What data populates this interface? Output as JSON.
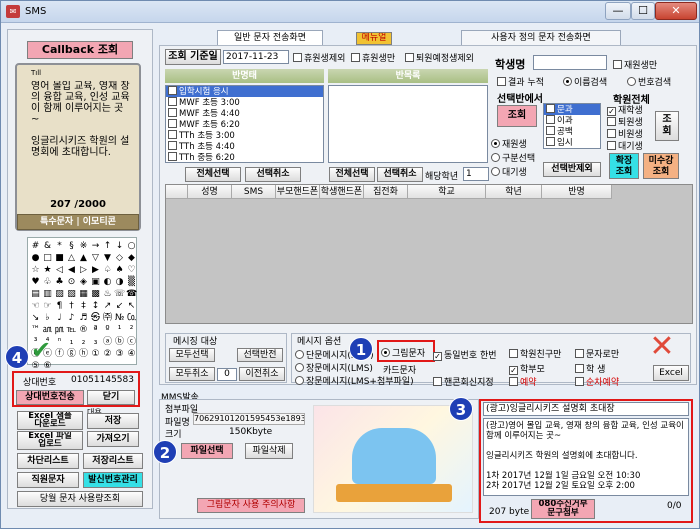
{
  "window": {
    "title": "SMS",
    "minimize": "—",
    "maximize": "☐",
    "close": "✕"
  },
  "phone": {
    "callback_label": "Callback 조회",
    "signal": "Tıll",
    "message": "영어 몰입 교육, 영재 창의 융합 교육, 인성 교육이 함께 이루어지는 곳~\n\n잉글리시키즈 학원의 설명회에 초대합니다.",
    "counter": "207 /2000",
    "special_chars": "특수문자 | 이모티콘"
  },
  "symbols": [
    "#",
    "&",
    "*",
    "§",
    "※",
    "→",
    "↑",
    "↓",
    "○",
    "●",
    "□",
    "■",
    "△",
    "▲",
    "▽",
    "▼",
    "◇",
    "◆",
    "☆",
    "★",
    "◁",
    "◀",
    "▷",
    "▶",
    "♤",
    "♠",
    "♡",
    "♥",
    "♧",
    "♣",
    "⊙",
    "◈",
    "▣",
    "◐",
    "◑",
    "▒",
    "▤",
    "▥",
    "▨",
    "▧",
    "▦",
    "▩",
    "♨",
    "☏",
    "☎",
    "☜",
    "☞",
    "¶",
    "†",
    "‡",
    "↕",
    "↗",
    "↙",
    "↖",
    "↘",
    "♭",
    "♩",
    "♪",
    "♬",
    "㉿",
    "㈜",
    "№",
    "㏇",
    "™",
    "㏂",
    "㏘",
    "℡",
    "®",
    "ª",
    "º",
    "¹",
    "²",
    "³",
    "⁴",
    "ⁿ",
    "₁",
    "₂",
    "₃",
    "ⓐ",
    "ⓑ",
    "ⓒ",
    "ⓓ",
    "ⓔ",
    "ⓕ",
    "ⓖ",
    "ⓗ",
    "①",
    "②",
    "③",
    "④",
    "⑤",
    "⑥"
  ],
  "counterpart": {
    "label": "상대번호",
    "number": "01051145583",
    "transmit_button": "상대번호전송",
    "close_button": "닫기"
  },
  "left_buttons": {
    "excel_form_download": "Excel 샘플\n다운로드",
    "excel_file_upload": "Excel 파일\n업로드",
    "sample_label": "대용",
    "save": "저장",
    "import": "가져오기",
    "block_list": "차단리스트",
    "save_list": "저장리스트",
    "staff_number": "직원문자",
    "send_number_manage": "발신번호관리",
    "monthly_usage": "당월 문자 사용량조회"
  },
  "tabs": {
    "general": "일반 문자 전송화면",
    "manual": "메뉴얼",
    "custom": "사용자 정의 문자 전송화면"
  },
  "criteria": {
    "label": "조회 기준일",
    "date": "2017-11-23",
    "opt1": "휴원생제외",
    "opt2": "휴원생만",
    "opt3": "퇴원예정생제외"
  },
  "class_header": "반명태",
  "repeat_header": "반목록",
  "classes": [
    "입학시험 응시",
    "MWF 초등 3:00",
    "MWF 초등 4:40",
    "MWF 초등 6:20",
    "TTh 초등 3:00",
    "TTh 초등 4:40",
    "TTh 중등 6:20"
  ],
  "class_buttons": {
    "select_all": "전체선택",
    "select_cancel": "선택취소",
    "select_all2": "전체선택",
    "select_cancel2": "선택취소",
    "grade_label": "해당학년",
    "grade_value": "1"
  },
  "student": {
    "label": "학생명",
    "current_only": "재원생만",
    "result_accum": "결과 누적",
    "name_search": "이름검색",
    "number_search": "번호검색"
  },
  "class_select": {
    "title": "선택반에서",
    "search": "조회",
    "current": "재원생",
    "division": "구분선택",
    "waiting": "대기생",
    "class_remove": "선택반제외",
    "types": [
      "문과",
      "이과",
      "공백",
      "임시"
    ],
    "confirm": "확장\n조회",
    "unpaid": "미수강\n조회"
  },
  "academy": {
    "title": "학원전체",
    "items": [
      "재학생",
      "퇴원생",
      "비원생",
      "대기생"
    ],
    "search": "조\n회"
  },
  "grid_columns": [
    "성명",
    "SMS",
    "부모핸드폰",
    "학생핸드폰",
    "집전화",
    "학교",
    "학년",
    "반명"
  ],
  "msg_target": {
    "title": "메시징 대상",
    "select_all": "모두선택",
    "select_invert": "선택반전",
    "cancel_all": "모두취소",
    "count": "0",
    "prev_cancel": "이전취소"
  },
  "msg_option": {
    "title": "메시지 옵션",
    "single": "단문메시지(SMS)",
    "long": "장문메시지(LMS)",
    "long_attach": "장문메시지(LMS+첨부파일)",
    "picture": "그림문자",
    "same_number": "동일번호 한번",
    "card_msg": "카드문자",
    "academy_only": "학원친구만",
    "parents": "학부모",
    "student": "학 생",
    "phone_only": "문자로만",
    "guardian": "핸콘회신지정",
    "reserve": "예약",
    "sequential": "순차예약",
    "excel": "Excel"
  },
  "mms": {
    "title": "MMS발송",
    "attach_title": "첨부파일",
    "file_label": "파일명",
    "file_name": "70629101201595453e189354...1",
    "size_label": "크기",
    "size_value": "150Kbyte",
    "file_select": "파일선택",
    "file_delete": "파일삭제",
    "caution": "그림문자 사용 주의사항"
  },
  "compose": {
    "subject": "(광고)잉글리시키즈 설명회 초대장",
    "body": "(광고)영어 몰입 교육, 영재 창의 융합 교육, 인성 교육이 함께 이루어지는 곳~\n\n잉글리시키즈 학원의 설명회에 초대합니다.\n\n1차 2017년 12월 1일 금요일 오전 10:30\n2차 2017년 12월 2일 토요일 오후 2:00",
    "bytes": "207 byte",
    "reject_button": "080수신거부\n문구첨부",
    "count": "0/0"
  },
  "badges": [
    "1",
    "2",
    "3",
    "4"
  ],
  "colors": {
    "accent_pink": "#f3a6b3",
    "highlight_red": "#e11818",
    "badge_blue": "#1f3fb5",
    "cyan": "#35e0e6",
    "orange": "#f4b183"
  }
}
